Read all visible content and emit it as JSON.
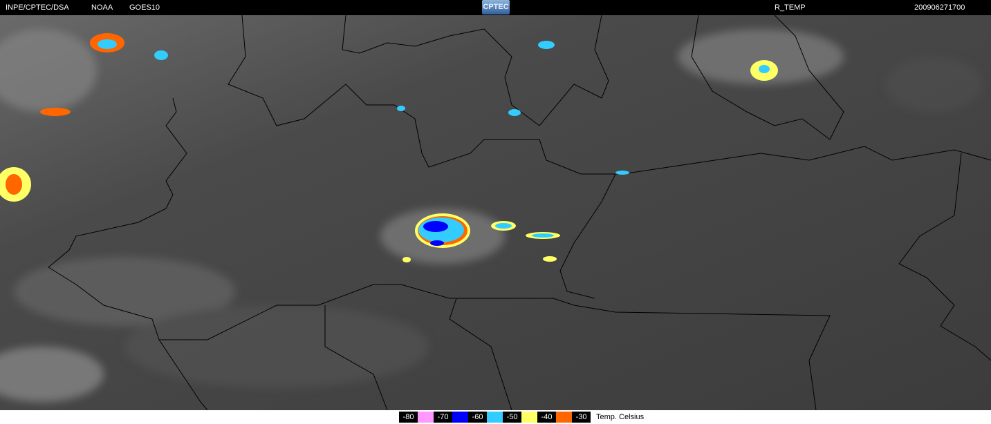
{
  "header": {
    "source": "INPE/CPTEC/DSA",
    "agency": "NOAA",
    "satellite": "GOES10",
    "logo": "CPTEC",
    "product": "R_TEMP",
    "datetime": "200906271700"
  },
  "legend": {
    "items": [
      {
        "label": "-80",
        "color": "#ff99ff"
      },
      {
        "label": "-70",
        "color": "#0000ff"
      },
      {
        "label": "-60",
        "color": "#33ccff"
      },
      {
        "label": "-50",
        "color": "#ffff66"
      },
      {
        "label": "-40",
        "color": "#ff6600"
      },
      {
        "label": "-30",
        "color": null
      }
    ],
    "unit": "Temp. Celsius"
  }
}
